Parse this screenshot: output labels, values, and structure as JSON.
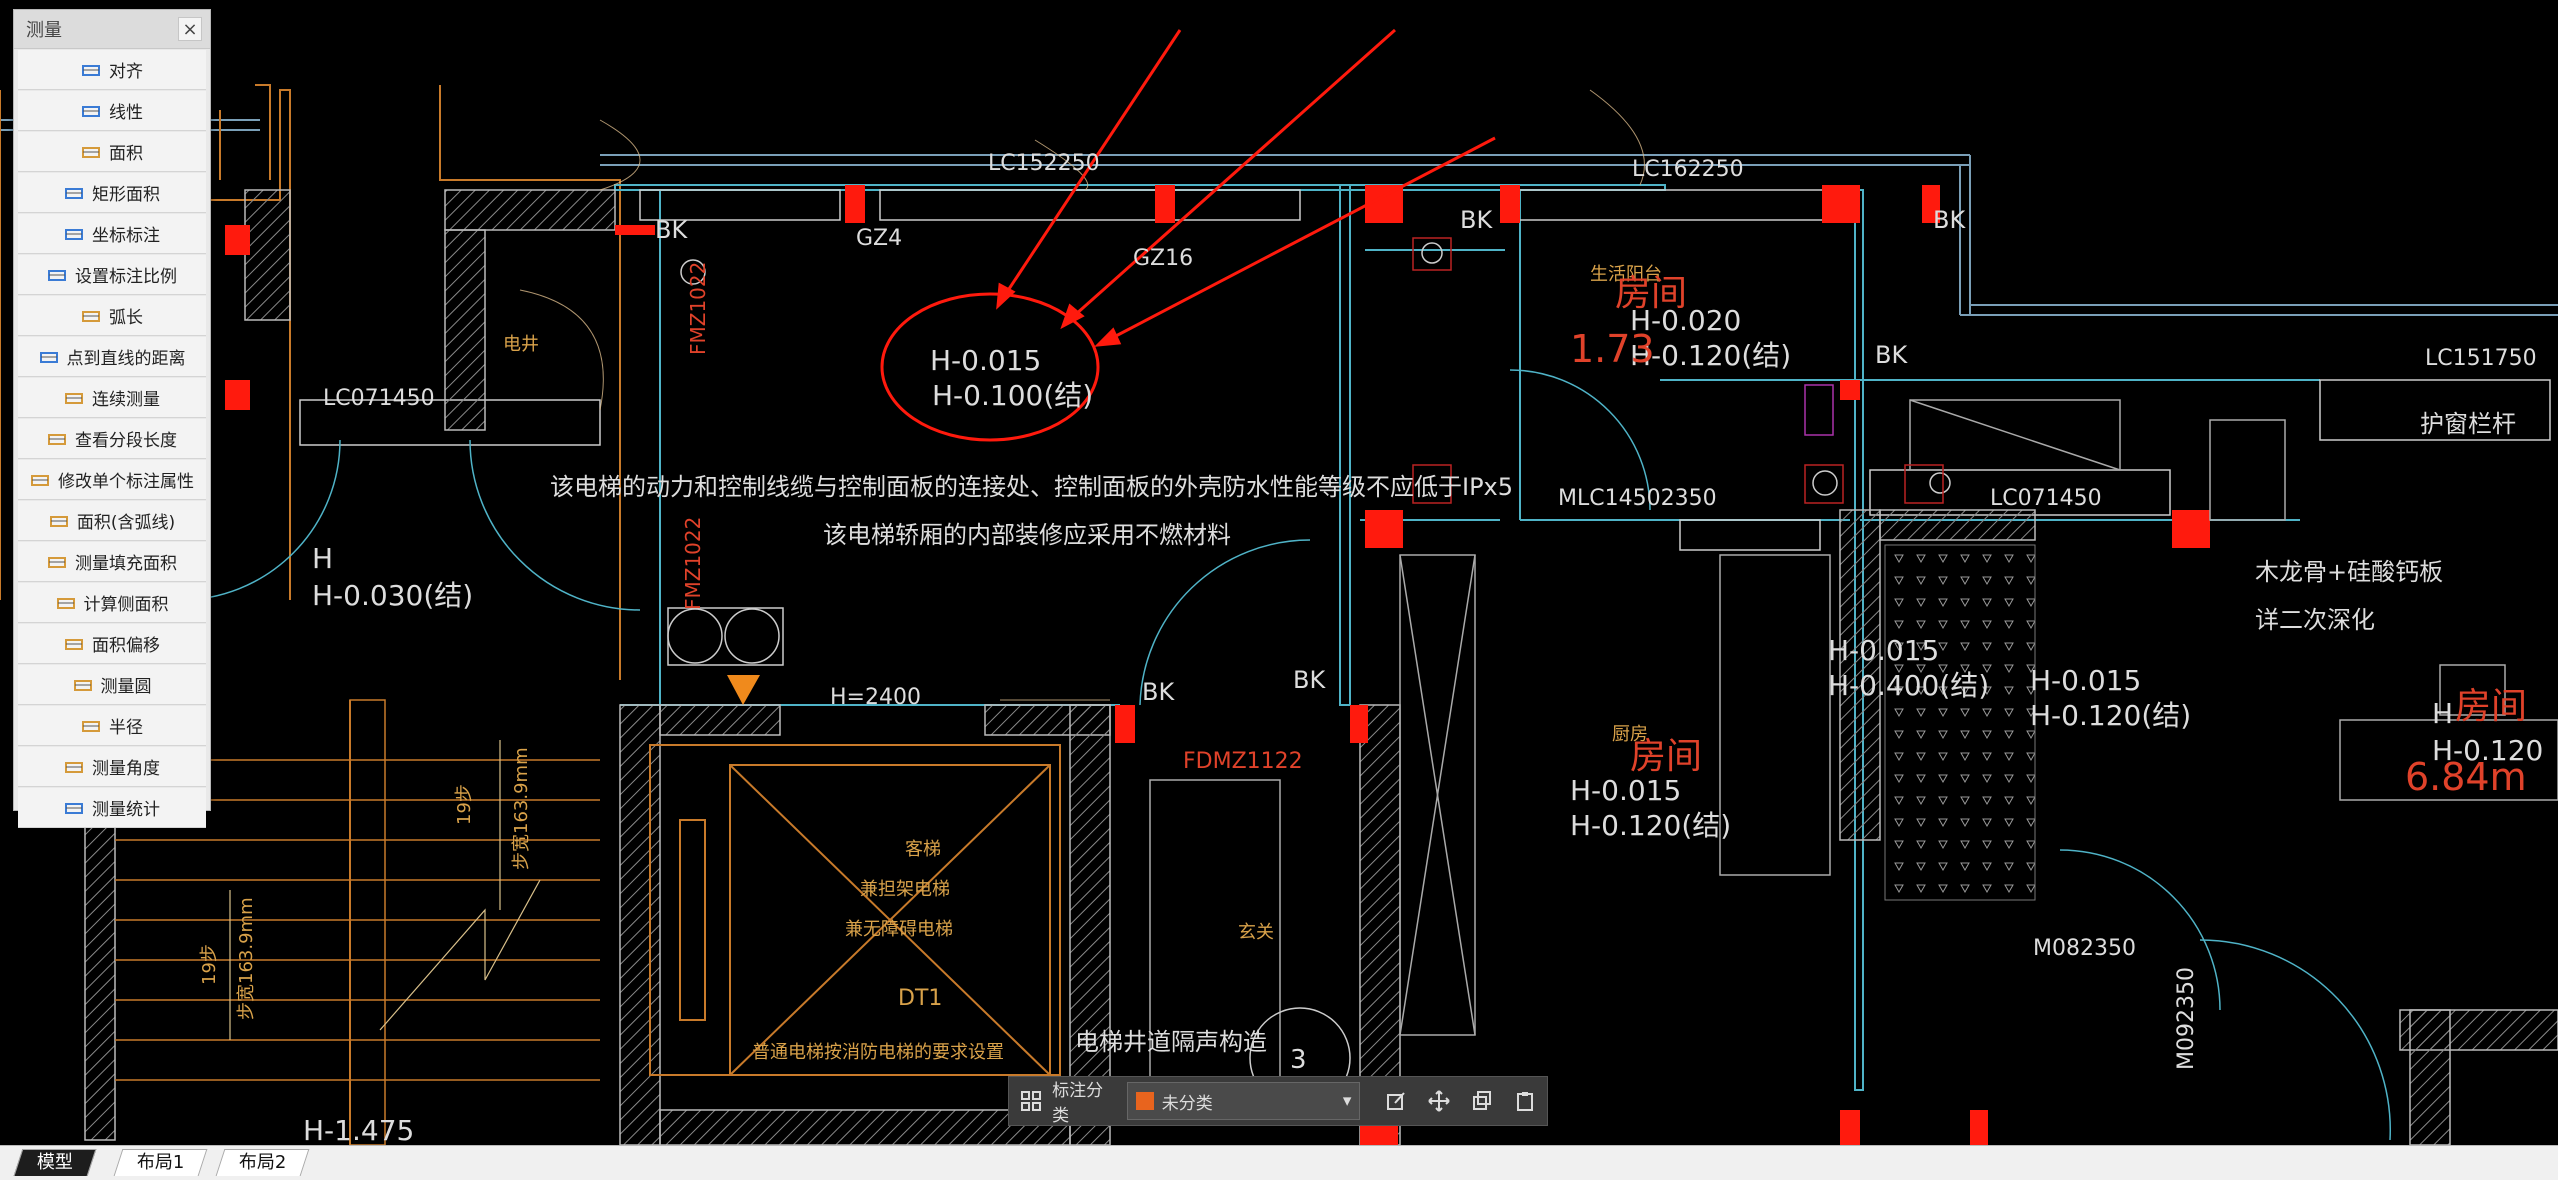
{
  "palette": {
    "title": "测量",
    "close": "×",
    "tools": [
      {
        "label": "对齐",
        "icon": "align-measure-icon"
      },
      {
        "label": "线性",
        "icon": "linear-measure-icon"
      },
      {
        "label": "面积",
        "icon": "area-icon"
      },
      {
        "label": "矩形面积",
        "icon": "rect-area-icon"
      },
      {
        "label": "坐标标注",
        "icon": "coordinate-icon"
      },
      {
        "label": "设置标注比例",
        "icon": "scale-icon"
      },
      {
        "label": "弧长",
        "icon": "arc-length-icon"
      },
      {
        "label": "点到直线的距离",
        "icon": "point-line-icon"
      },
      {
        "label": "连续测量",
        "icon": "continuous-measure-icon"
      },
      {
        "label": "查看分段长度",
        "icon": "segment-length-icon"
      },
      {
        "label": "修改单个标注属性",
        "icon": "edit-annotation-icon"
      },
      {
        "label": "面积(含弧线)",
        "icon": "arc-area-icon"
      },
      {
        "label": "测量填充面积",
        "icon": "fill-area-icon"
      },
      {
        "label": "计算侧面积",
        "icon": "side-area-icon"
      },
      {
        "label": "面积偏移",
        "icon": "area-offset-icon"
      },
      {
        "label": "测量圆",
        "icon": "circle-measure-icon"
      },
      {
        "label": "半径",
        "icon": "radius-icon"
      },
      {
        "label": "测量角度",
        "icon": "angle-icon"
      },
      {
        "label": "测量统计",
        "icon": "statistics-icon"
      }
    ]
  },
  "drawing": {
    "windows": [
      "LC152250",
      "LC162250",
      "LC071450",
      "LC071450",
      "LC151750",
      "MLC14502350"
    ],
    "doors": [
      "FDMZ1122",
      "FMZ1022",
      "M082350",
      "M092350"
    ],
    "columns": [
      "GZ4",
      "GZ16"
    ],
    "bk_labels": [
      "BK",
      "BK",
      "BK",
      "BK",
      "BK",
      "BK"
    ],
    "elevations": {
      "circled_top": "H-0.015",
      "circled_bottom": "H-0.100(结)",
      "left_top": "H",
      "left_bottom": "H-0.030(结)",
      "right1_top": "H-0.020",
      "right1_bottom": "H-0.120(结)",
      "mid_top": "H-0.015",
      "mid_bottom": "H-0.120(结)",
      "center_right_top": "H-0.015",
      "center_right_bottom": "H-0.400(结)",
      "far_right_top": "H-0.015",
      "far_right_bottom": "H-0.120(结)",
      "edge_top": "H",
      "edge_bottom": "H-0.120",
      "stair": "H-1.475",
      "lift_height": "H=2400"
    },
    "notes": {
      "note1": "该电梯的动力和控制线缆与控制面板的连接处、控制面板的外壳防水性能等级不应低于IPx5",
      "note2": "该电梯轿厢的内部装修应采用不燃材料",
      "partition": "木龙骨+硅酸钙板",
      "partition2": "详二次深化",
      "guardrail": "护窗栏杆",
      "shaft": "电梯井道隔声构造",
      "elevator": "普通电梯按消防电梯的要求设置"
    },
    "rooms": {
      "electric_shaft": "电井",
      "balcony": "生活阳台",
      "kitchen": "厨房",
      "foyer": "玄关",
      "lift1": "客梯",
      "lift2": "兼担架电梯",
      "lift3": "兼无障碍电梯",
      "lift_id": "DT1",
      "room": "房间"
    },
    "stairs": {
      "steps_a": "19步",
      "width_a": "步宽163.9mm",
      "steps_b": "19步",
      "width_b": "步宽163.9mm"
    },
    "area_values": {
      "a": "1.73",
      "b": "6.84m"
    },
    "circle_marker": "3"
  },
  "anno_bar": {
    "category_label": "标注分类",
    "selected": "未分类"
  },
  "tabs": [
    "模型",
    "布局1",
    "布局2"
  ]
}
